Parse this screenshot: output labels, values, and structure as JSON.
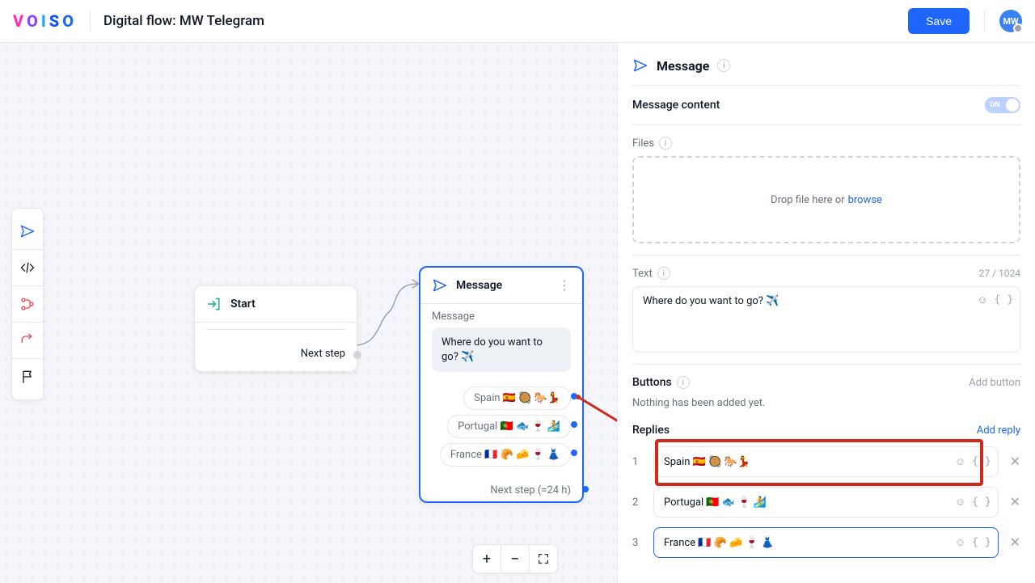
{
  "header": {
    "page_title": "Digital flow: MW Telegram",
    "save_label": "Save",
    "avatar_initials": "MW"
  },
  "canvas": {
    "start": {
      "title": "Start",
      "next_label": "Next step"
    },
    "message": {
      "title": "Message",
      "subtitle": "Message",
      "bubble_text": "Where do you want to go? ✈️",
      "replies": {
        "r1": "Spain 🇪🇸 🥘 🐎💃",
        "r2": "Portugal 🇵🇹 🐟 🍷 🏄",
        "r3": "France 🇫🇷 🥐 🧀 🍷 👗"
      },
      "next_label": "Next step (=24 h)"
    },
    "zoom": {
      "plus": "+",
      "minus": "−"
    }
  },
  "panel": {
    "title": "Message",
    "content_label": "Message content",
    "toggle_state": "ON",
    "files_label": "Files",
    "dropzone_text": "Drop file here or",
    "dropzone_link": "browse",
    "text_label": "Text",
    "text_counter": "27 / 1024",
    "text_value": "Where do you want to go? ✈️",
    "buttons_label": "Buttons",
    "buttons_action": "Add button",
    "buttons_empty": "Nothing has been added yet.",
    "replies_label": "Replies",
    "replies_action": "Add reply",
    "reply_rows": {
      "r1": {
        "idx": "1",
        "value": "Spain 🇪🇸 🥘 🐎💃"
      },
      "r2": {
        "idx": "2",
        "value": "Portugal 🇵🇹 🐟 🍷 🏄"
      },
      "r3": {
        "idx": "3",
        "value": "France 🇫🇷 🥐 🧀 🍷 👗"
      }
    }
  }
}
